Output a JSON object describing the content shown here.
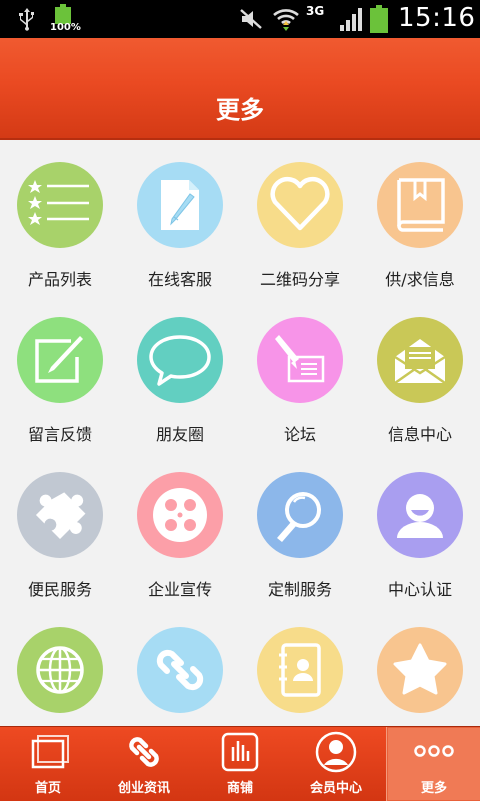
{
  "status_bar": {
    "battery_percent": "100%",
    "network": "3G",
    "time": "15:16"
  },
  "header": {
    "title": "更多"
  },
  "grid": [
    {
      "label": "产品列表",
      "icon": "product-list-icon",
      "color": "#a8d26a"
    },
    {
      "label": "在线客服",
      "icon": "online-service-icon",
      "color": "#a6dcf4"
    },
    {
      "label": "二维码分享",
      "icon": "qr-share-icon",
      "color": "#f7dc8a"
    },
    {
      "label": "供/求信息",
      "icon": "supply-demand-icon",
      "color": "#f8c58f"
    },
    {
      "label": "留言反馈",
      "icon": "feedback-icon",
      "color": "#8ee07e"
    },
    {
      "label": "朋友圈",
      "icon": "friends-circle-icon",
      "color": "#62cfc1"
    },
    {
      "label": "论坛",
      "icon": "forum-icon",
      "color": "#f794e8"
    },
    {
      "label": "信息中心",
      "icon": "info-center-icon",
      "color": "#c9c857"
    },
    {
      "label": "便民服务",
      "icon": "convenience-service-icon",
      "color": "#c1c8d2"
    },
    {
      "label": "企业宣传",
      "icon": "enterprise-promo-icon",
      "color": "#fc9fa8"
    },
    {
      "label": "定制服务",
      "icon": "custom-service-icon",
      "color": "#8cb7ea"
    },
    {
      "label": "中心认证",
      "icon": "center-certification-icon",
      "color": "#a99ef0"
    },
    {
      "label": "",
      "icon": "globe-icon",
      "color": "#a8d26a"
    },
    {
      "label": "",
      "icon": "link-icon",
      "color": "#a6dcf4"
    },
    {
      "label": "",
      "icon": "contacts-icon",
      "color": "#f7dc8a"
    },
    {
      "label": "",
      "icon": "star-icon",
      "color": "#f8c58f"
    }
  ],
  "tabbar": {
    "tabs": [
      {
        "label": "首页",
        "icon": "home-icon"
      },
      {
        "label": "创业资讯",
        "icon": "link-icon"
      },
      {
        "label": "商铺",
        "icon": "shop-icon"
      },
      {
        "label": "会员中心",
        "icon": "member-icon"
      },
      {
        "label": "更多",
        "icon": "more-icon",
        "active": true
      }
    ]
  }
}
